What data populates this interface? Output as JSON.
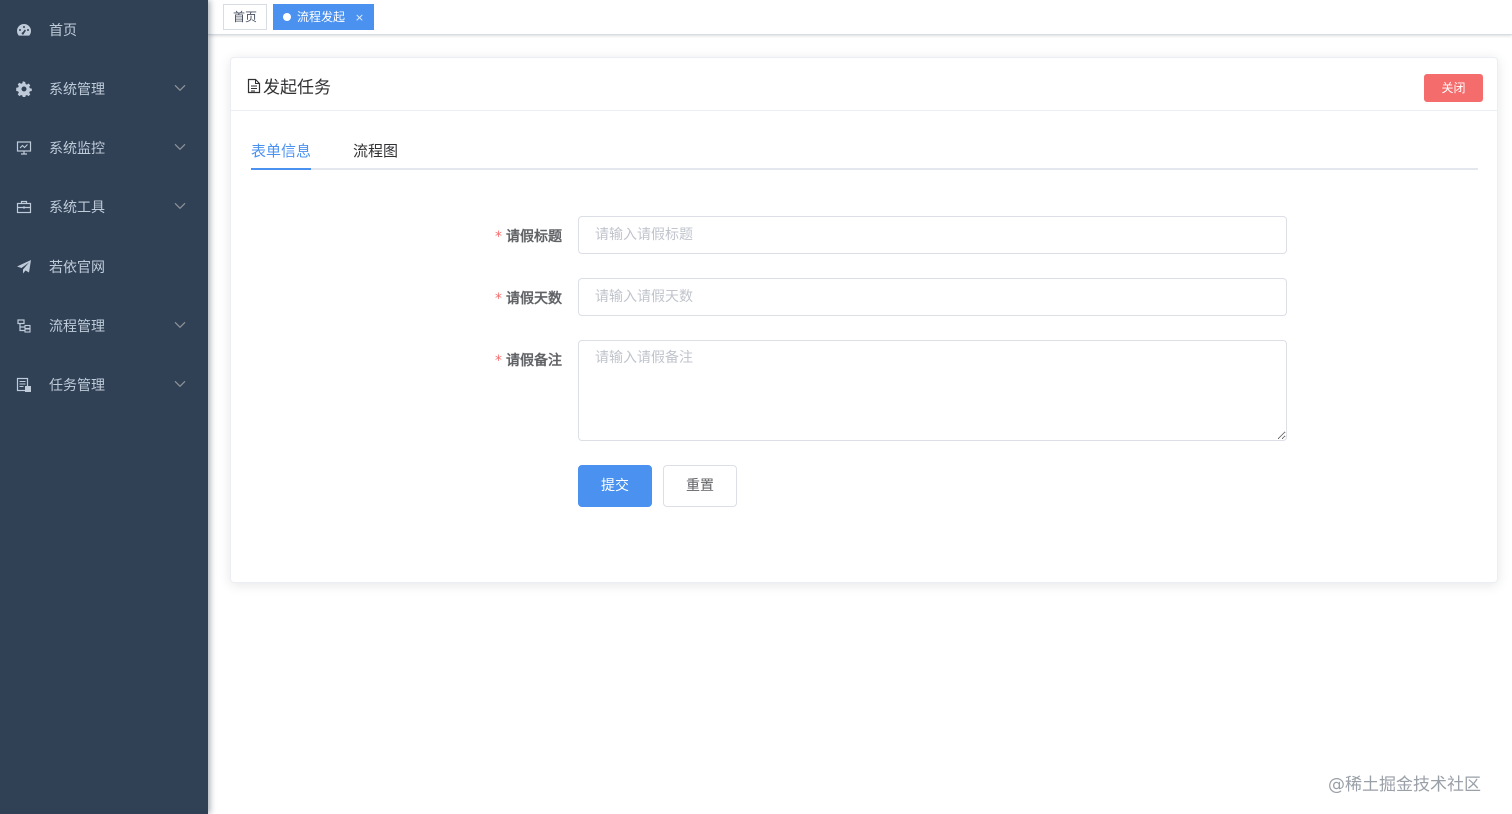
{
  "sidebar": {
    "items": [
      {
        "label": "首页",
        "icon": "dashboard-icon",
        "has_children": false
      },
      {
        "label": "系统管理",
        "icon": "gear-icon",
        "has_children": true
      },
      {
        "label": "系统监控",
        "icon": "monitor-icon",
        "has_children": true
      },
      {
        "label": "系统工具",
        "icon": "toolbox-icon",
        "has_children": true
      },
      {
        "label": "若依官网",
        "icon": "send-icon",
        "has_children": false
      },
      {
        "label": "流程管理",
        "icon": "flow-icon",
        "has_children": true
      },
      {
        "label": "任务管理",
        "icon": "task-icon",
        "has_children": true
      }
    ],
    "colors": {
      "background": "#304156",
      "text": "#bfcbd9"
    }
  },
  "tags": [
    {
      "label": "首页",
      "active": false
    },
    {
      "label": "流程发起",
      "active": true,
      "close": "×"
    }
  ],
  "card": {
    "title": "发起任务",
    "close_button": "关闭"
  },
  "tabs": [
    {
      "label": "表单信息",
      "active": true
    },
    {
      "label": "流程图",
      "active": false
    }
  ],
  "form": {
    "fields": [
      {
        "label": "请假标题",
        "required_mark": "*",
        "placeholder": "请输入请假标题",
        "value": ""
      },
      {
        "label": "请假天数",
        "required_mark": "*",
        "placeholder": "请输入请假天数",
        "value": ""
      },
      {
        "label": "请假备注",
        "required_mark": "*",
        "placeholder": "请输入请假备注",
        "value": ""
      }
    ],
    "submit_label": "提交",
    "reset_label": "重置"
  },
  "watermark": "@稀土掘金技术社区",
  "colors": {
    "primary": "#4a91f0",
    "danger": "#f56c6c",
    "required": "#f56c6c"
  }
}
